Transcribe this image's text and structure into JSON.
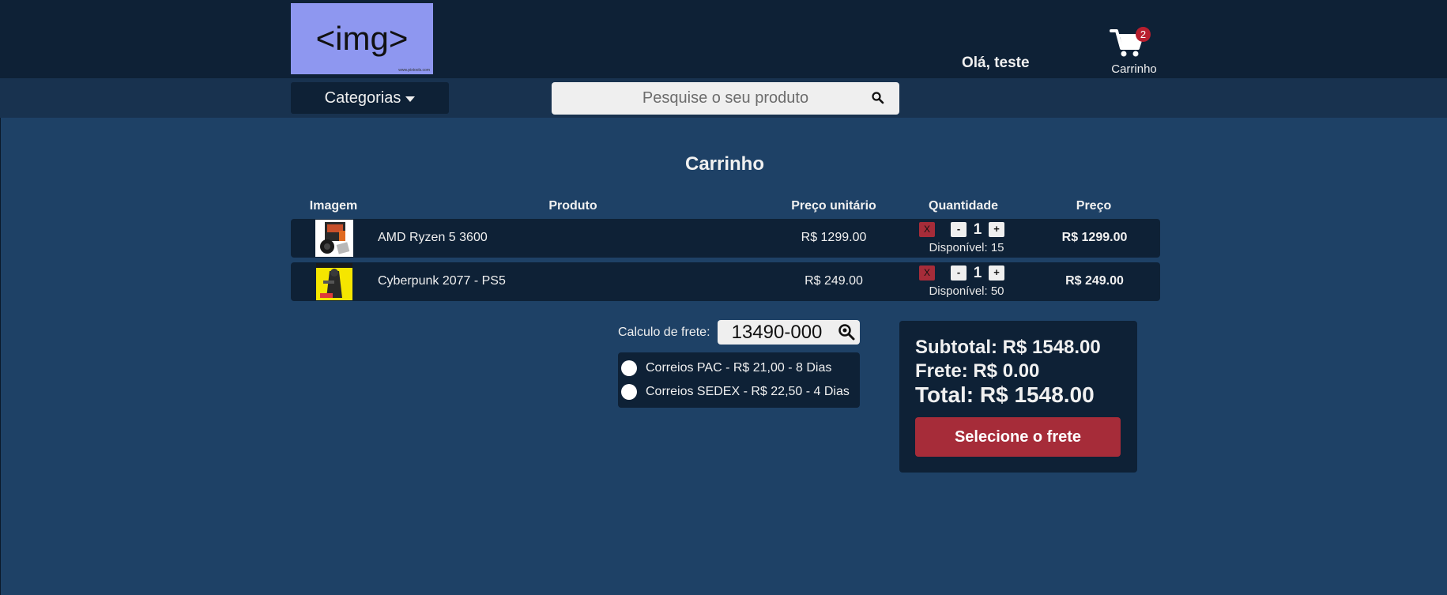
{
  "header": {
    "logo_text": "<img>",
    "logo_small": "www.pixtools.com",
    "greeting": "Olá, teste",
    "cart_label": "Carrinho",
    "cart_count": "2"
  },
  "nav": {
    "categories_label": "Categorias",
    "search_placeholder": "Pesquise o seu produto"
  },
  "page": {
    "title": "Carrinho"
  },
  "table": {
    "columns": [
      "Imagem",
      "Produto",
      "Preço unitário",
      "Quantidade",
      "Preço"
    ],
    "rows": [
      {
        "product": "AMD Ryzen 5 3600",
        "unit_price": "R$ 1299.00",
        "remove": "X",
        "minus": "-",
        "quantity": "1",
        "plus": "+",
        "available": "Disponível: 15",
        "price": "R$ 1299.00"
      },
      {
        "product": "Cyberpunk 2077 - PS5",
        "unit_price": "R$ 249.00",
        "remove": "X",
        "minus": "-",
        "quantity": "1",
        "plus": "+",
        "available": "Disponível: 50",
        "price": "R$ 249.00"
      }
    ]
  },
  "shipping": {
    "label": "Calculo de frete:",
    "cep_value": "13490-000",
    "options": [
      "Correios PAC - R$ 21,00 - 8 Dias",
      "Correios SEDEX - R$ 22,50 - 4 Dias"
    ]
  },
  "summary": {
    "subtotal": "Subtotal: R$ 1548.00",
    "frete": "Frete: R$ 0.00",
    "total": "Total: R$ 1548.00",
    "button": "Selecione o frete"
  },
  "colors": {
    "background": "#1e4166",
    "header": "#0e2136",
    "navbar": "#18324f",
    "accent_red": "#a62c39",
    "logo_bg": "#8e97f0"
  }
}
